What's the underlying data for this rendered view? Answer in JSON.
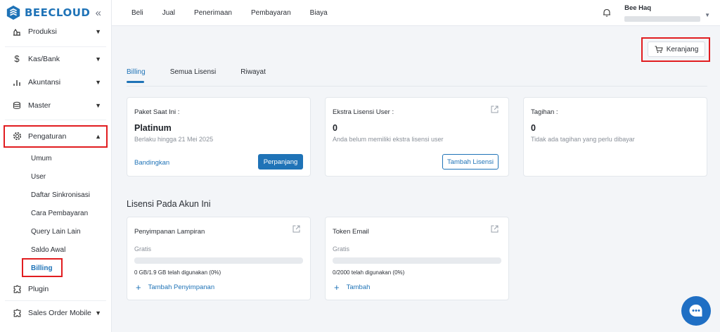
{
  "brand": {
    "name": "BEECLOUD"
  },
  "sidebar": {
    "items": [
      {
        "label": "Produksi"
      },
      {
        "label": "Kas/Bank"
      },
      {
        "label": "Akuntansi"
      },
      {
        "label": "Master"
      },
      {
        "label": "Pengaturan"
      },
      {
        "label": "Plugin"
      },
      {
        "label": "Sales Order Mobile"
      }
    ],
    "sub_items": [
      "Umum",
      "User",
      "Daftar Sinkronisasi",
      "Cara Pembayaran",
      "Query Lain Lain",
      "Saldo Awal",
      "Billing"
    ]
  },
  "topmenu": [
    "Beli",
    "Jual",
    "Penerimaan",
    "Pembayaran",
    "Biaya"
  ],
  "user": {
    "name": "Bee Haq"
  },
  "cart": {
    "label": "Keranjang"
  },
  "tabs": [
    "Billing",
    "Semua Lisensi",
    "Riwayat"
  ],
  "cards": {
    "paket": {
      "title": "Paket Saat Ini :",
      "value": "Platinum",
      "sub": "Berlaku hingga 21 Mei 2025",
      "compare": "Bandingkan",
      "renew": "Perpanjang"
    },
    "ekstra": {
      "title": "Ekstra Lisensi User :",
      "value": "0",
      "sub": "Anda belum memiliki ekstra lisensi user",
      "add": "Tambah Lisensi"
    },
    "tagihan": {
      "title": "Tagihan :",
      "value": "0",
      "sub": "Tidak ada tagihan yang perlu dibayar"
    }
  },
  "section": {
    "title": "Lisensi Pada Akun Ini"
  },
  "licenses": {
    "storage": {
      "title": "Penyimpanan Lampiran",
      "plan": "Gratis",
      "usage": "0 GB/1.9 GB telah digunakan (0%)",
      "usage_fraction": 0,
      "add": "Tambah Penyimpanan"
    },
    "token": {
      "title": "Token Email",
      "plan": "Gratis",
      "usage": "0/2000 telah digunakan (0%)",
      "usage_fraction": 0,
      "add": "Tambah"
    }
  },
  "colors": {
    "accent": "#1f73b7",
    "highlight": "#e11d20"
  }
}
